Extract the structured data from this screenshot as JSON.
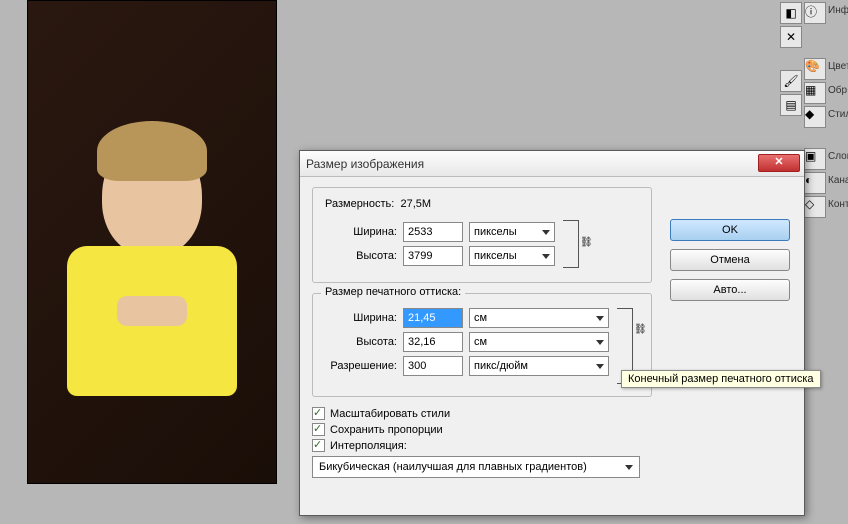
{
  "dialog": {
    "title": "Размер изображения",
    "pixel_dimensions": {
      "legend": "Размерность:",
      "size": "27,5M",
      "width_label": "Ширина:",
      "width_value": "2533",
      "width_unit": "пикселы",
      "height_label": "Высота:",
      "height_value": "3799",
      "height_unit": "пикселы"
    },
    "document_size": {
      "legend": "Размер печатного оттиска:",
      "width_label": "Ширина:",
      "width_value": "21,45",
      "width_unit": "см",
      "height_label": "Высота:",
      "height_value": "32,16",
      "height_unit": "см",
      "resolution_label": "Разрешение:",
      "resolution_value": "300",
      "resolution_unit": "пикс/дюйм"
    },
    "checkboxes": {
      "scale_styles": "Масштабировать стили",
      "constrain": "Сохранить пропорции",
      "resample": "Интерполяция:"
    },
    "interpolation": "Бикубическая (наилучшая для плавных градиентов)",
    "buttons": {
      "ok": "OK",
      "cancel": "Отмена",
      "auto": "Авто..."
    },
    "tooltip": "Конечный размер печатного оттиска"
  },
  "panels": {
    "info": "Инф",
    "color": "Цвет",
    "samples": "Обр",
    "styles": "Стил",
    "layers": "Слои",
    "channels": "Кана",
    "paths": "Конт"
  }
}
